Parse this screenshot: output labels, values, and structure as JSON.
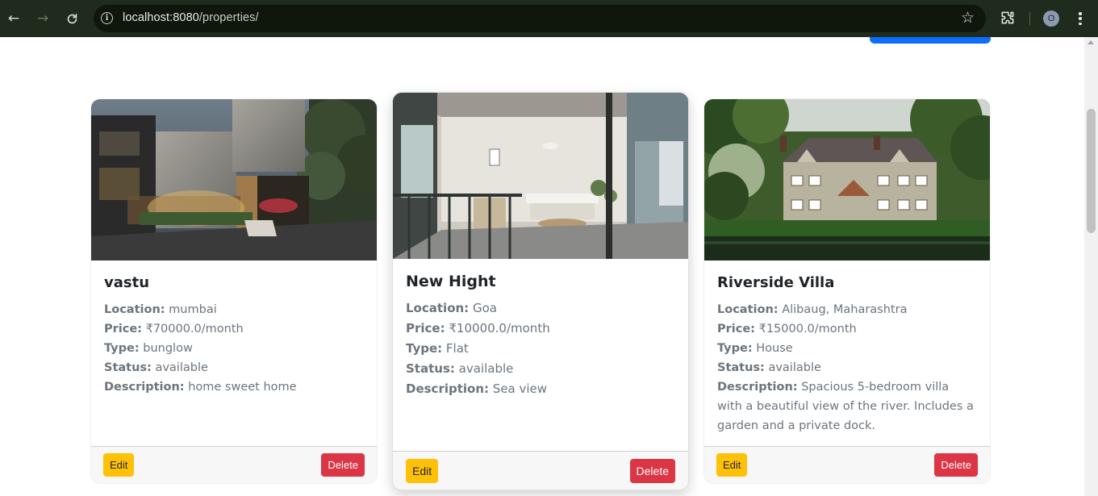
{
  "browser": {
    "url_host": "localhost:8080",
    "url_path": "/properties/",
    "profile_initial": "O"
  },
  "properties": [
    {
      "title": "vastu",
      "location_label": "Location:",
      "location": "mumbai",
      "price_label": "Price:",
      "price": "₹70000.0/month",
      "type_label": "Type:",
      "type": "bunglow",
      "status_label": "Status:",
      "status": "available",
      "description_label": "Description:",
      "description": "home sweet home",
      "image": "modern-house-photo"
    },
    {
      "title": "New Hight",
      "location_label": "Location:",
      "location": "Goa",
      "price_label": "Price:",
      "price": "₹10000.0/month",
      "type_label": "Type:",
      "type": "Flat",
      "status_label": "Status:",
      "status": "available",
      "description_label": "Description:",
      "description": "Sea view",
      "image": "apartment-interior-photo"
    },
    {
      "title": "Riverside Villa",
      "location_label": "Location:",
      "location": "Alibaug, Maharashtra",
      "price_label": "Price:",
      "price": "₹15000.0/month",
      "type_label": "Type:",
      "type": "House",
      "status_label": "Status:",
      "status": "available",
      "description_label": "Description:",
      "description": "Spacious 5-bedroom villa with a beautiful view of the river. Includes a garden and a private dock.",
      "image": "riverside-villa-photo"
    }
  ],
  "buttons": {
    "edit_label": "Edit",
    "delete_label": "Delete"
  },
  "colors": {
    "edit_button": "#ffc107",
    "delete_button": "#dc3545",
    "primary": "#0d6efd",
    "chrome_bar": "#1f2b1c"
  },
  "icons": {
    "back": "arrow-left-icon",
    "forward": "arrow-right-icon",
    "reload": "reload-icon",
    "site_info": "info-icon",
    "bookmark": "star-icon",
    "extensions": "puzzle-icon",
    "menu": "kebab-menu-icon"
  }
}
